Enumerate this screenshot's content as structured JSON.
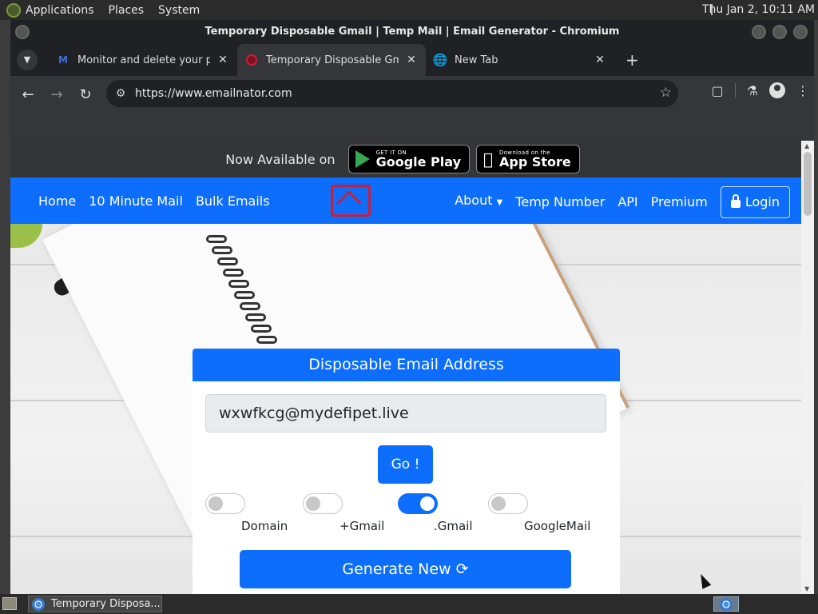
{
  "system_panel": {
    "menus": [
      "Applications",
      "Places",
      "System"
    ],
    "clock": "Thu Jan  2, 10:11 AM"
  },
  "window": {
    "title": "Temporary Disposable Gmail | Temp Mail | Email Generator - Chromium"
  },
  "tabs": [
    {
      "title": "Monitor and delete your pers",
      "favicon": "monitor-m-icon",
      "active": false
    },
    {
      "title": "Temporary Disposable Gmai",
      "favicon": "emailnator-icon",
      "active": true
    },
    {
      "title": "New Tab",
      "favicon": "globe-icon",
      "active": false
    }
  ],
  "toolbar": {
    "url": "https://www.emailnator.com"
  },
  "app_banner": {
    "text": "Now Available on",
    "google_play_small": "GET IT ON",
    "google_play_big": "Google Play",
    "app_store_small": "Download on the",
    "app_store_big": "App Store"
  },
  "navbar": {
    "left": [
      "Home",
      "10 Minute Mail",
      "Bulk Emails"
    ],
    "about": "About",
    "temp_number": "Temp Number",
    "api": "API",
    "premium": "Premium",
    "login": "Login"
  },
  "card": {
    "header": "Disposable Email Address",
    "email": "wxwfkcg@mydefipet.live",
    "go_label": "Go !",
    "options": [
      {
        "label": "Domain",
        "checked": false
      },
      {
        "label": "+Gmail",
        "checked": false
      },
      {
        "label": ".Gmail",
        "checked": true
      },
      {
        "label": "GoogleMail",
        "checked": false
      }
    ],
    "generate_label": "Generate New"
  },
  "taskbar": {
    "task_title": "Temporary Disposa..."
  },
  "colors": {
    "primary": "#0d6efd",
    "brand_red": "#c81e3a"
  }
}
